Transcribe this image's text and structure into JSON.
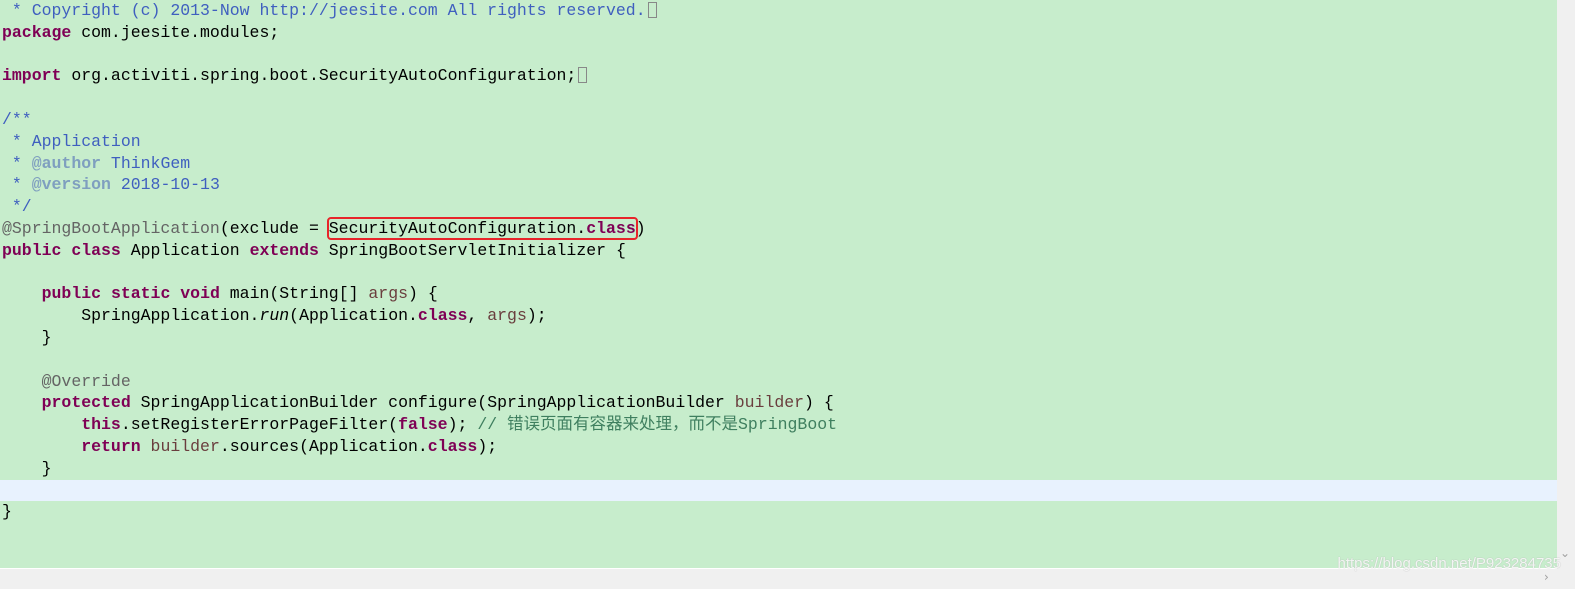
{
  "colors": {
    "background": "#c7edcc",
    "current_line": "#e8f2fe",
    "keyword": "#7f0055",
    "javadoc": "#3f5fbf",
    "javadoc_tag": "#7f9fbf",
    "annotation": "#646464",
    "variable": "#6a3e3e",
    "line_comment": "#3f7f5f",
    "highlight_box": "#e8252a"
  },
  "code_lines": [
    [
      {
        "t": " * Copyright (c) 2013-Now http://jeesite.com All rights reserved.",
        "c": "jd"
      },
      {
        "fold": true
      }
    ],
    [
      {
        "t": "package",
        "c": "kw"
      },
      {
        "t": " com.jeesite.modules;"
      }
    ],
    [],
    [
      {
        "t": "import",
        "c": "kw"
      },
      {
        "t": " org.activiti.spring.boot.SecurityAutoConfiguration;"
      },
      {
        "fold": true
      }
    ],
    [],
    [
      {
        "t": "/**",
        "c": "jd"
      }
    ],
    [
      {
        "t": " * Application",
        "c": "jd"
      }
    ],
    [
      {
        "t": " * ",
        "c": "jd"
      },
      {
        "t": "@author",
        "c": "tag"
      },
      {
        "t": " ThinkGem",
        "c": "jd"
      }
    ],
    [
      {
        "t": " * ",
        "c": "jd"
      },
      {
        "t": "@version",
        "c": "tag"
      },
      {
        "t": " 2018-10-13",
        "c": "jd"
      }
    ],
    [
      {
        "t": " */",
        "c": "jd"
      }
    ],
    [
      {
        "t": "@SpringBootApplication",
        "c": "ann"
      },
      {
        "t": "(exclude = "
      },
      {
        "group": "hl",
        "parts": [
          {
            "t": "SecurityAutoConfiguration."
          },
          {
            "t": "class",
            "c": "kw"
          }
        ]
      },
      {
        "t": ")"
      }
    ],
    [
      {
        "t": "public",
        "c": "kw"
      },
      {
        "t": " "
      },
      {
        "t": "class",
        "c": "kw"
      },
      {
        "t": " Application "
      },
      {
        "t": "extends",
        "c": "kw"
      },
      {
        "t": " SpringBootServletInitializer {"
      }
    ],
    [],
    [
      {
        "t": "    "
      },
      {
        "t": "public",
        "c": "kw"
      },
      {
        "t": " "
      },
      {
        "t": "static",
        "c": "kw"
      },
      {
        "t": " "
      },
      {
        "t": "void",
        "c": "kw"
      },
      {
        "t": " main(String[] "
      },
      {
        "t": "args",
        "c": "var"
      },
      {
        "t": ") {"
      }
    ],
    [
      {
        "t": "        SpringApplication."
      },
      {
        "t": "run",
        "c": "it"
      },
      {
        "t": "(Application."
      },
      {
        "t": "class",
        "c": "kw"
      },
      {
        "t": ", "
      },
      {
        "t": "args",
        "c": "var"
      },
      {
        "t": ");"
      }
    ],
    [
      {
        "t": "    }"
      }
    ],
    [],
    [
      {
        "t": "    "
      },
      {
        "t": "@Override",
        "c": "ann"
      }
    ],
    [
      {
        "t": "    "
      },
      {
        "t": "protected",
        "c": "kw"
      },
      {
        "t": " SpringApplicationBuilder configure(SpringApplicationBuilder "
      },
      {
        "t": "builder",
        "c": "var"
      },
      {
        "t": ") {"
      }
    ],
    [
      {
        "t": "        "
      },
      {
        "t": "this",
        "c": "kw"
      },
      {
        "t": ".setRegisterErrorPageFilter("
      },
      {
        "t": "false",
        "c": "kw"
      },
      {
        "t": "); "
      },
      {
        "t": "// 错误页面有容器来处理，而不是SpringBoot",
        "c": "lc"
      }
    ],
    [
      {
        "t": "        "
      },
      {
        "t": "return",
        "c": "kw"
      },
      {
        "t": " "
      },
      {
        "t": "builder",
        "c": "var"
      },
      {
        "t": ".sources(Application."
      },
      {
        "t": "class",
        "c": "kw"
      },
      {
        "t": ");"
      }
    ],
    [
      {
        "t": "    }"
      }
    ],
    [],
    [
      {
        "t": "}"
      }
    ]
  ],
  "current_line_index": 22,
  "watermark": "https://blog.csdn.net/P923284735"
}
